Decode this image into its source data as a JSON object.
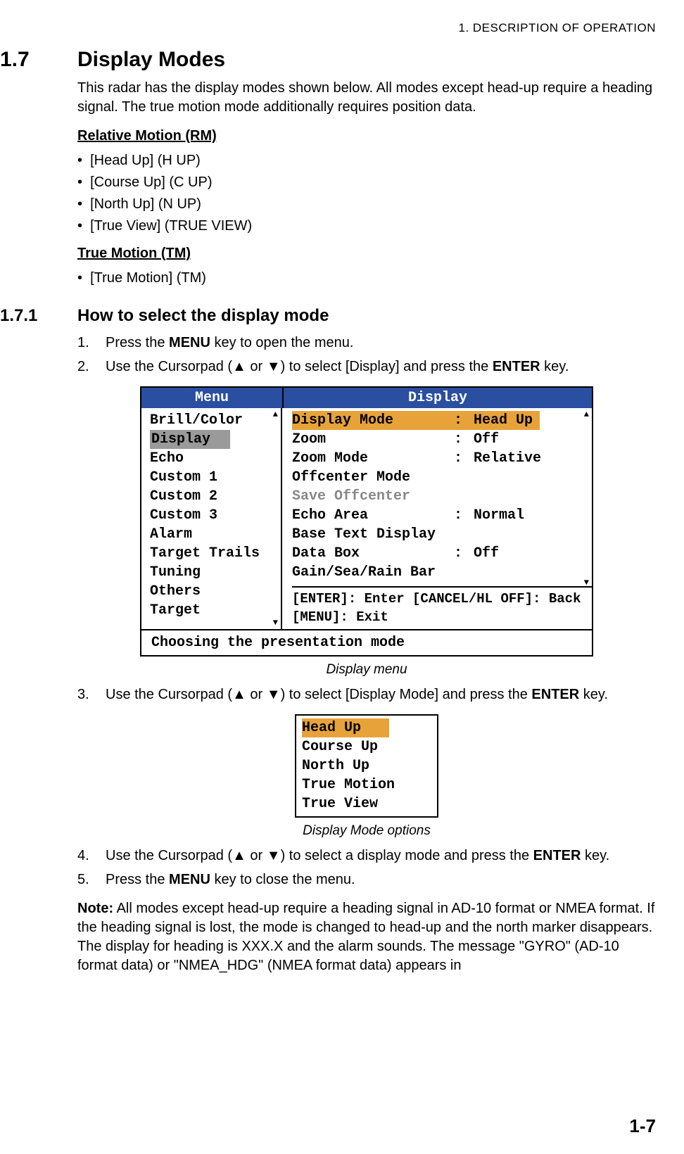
{
  "header": "1.  DESCRIPTION OF OPERATION",
  "section": {
    "num": "1.7",
    "title": "Display Modes"
  },
  "intro": "This radar has the display modes shown below. All modes except head-up require a heading signal. The true motion mode additionally requires position data.",
  "rm": {
    "heading": "Relative Motion (RM)",
    "items": [
      "[Head Up] (H UP)",
      "[Course Up] (C UP)",
      "[North Up] (N UP)",
      "[True View] (TRUE VIEW)"
    ]
  },
  "tm": {
    "heading": "True Motion (TM)",
    "items": [
      "[True Motion] (TM)"
    ]
  },
  "subsection": {
    "num": "1.7.1",
    "title": "How to select the display mode"
  },
  "steps": {
    "s1a": "Press the ",
    "s1b": "MENU",
    "s1c": " key to open the menu.",
    "s2a": "Use the Cursorpad (",
    "s2b": " or ",
    "s2c": ") to select [Display] and press the ",
    "s2d": "ENTER",
    "s2e": " key.",
    "s3a": "Use the Cursorpad (",
    "s3b": " or ",
    "s3c": ") to select [Display Mode] and press the ",
    "s3d": "ENTER",
    "s3e": " key.",
    "s4a": "Use the Cursorpad (",
    "s4b": " or ",
    "s4c": ") to select a display mode and press the ",
    "s4d": "ENTER",
    "s4e": " key.",
    "s5a": "Press the ",
    "s5b": "MENU",
    "s5c": " key to close the menu."
  },
  "arrows": {
    "up": "▲",
    "down": "▼"
  },
  "menu": {
    "head_left": "Menu",
    "head_right": "Display",
    "left_items": [
      "Brill/Color",
      "Display",
      "Echo",
      "Custom 1",
      "Custom 2",
      "Custom 3",
      "Alarm",
      "Target Trails",
      "Tuning",
      "Others",
      "Target"
    ],
    "left_selected_index": 1,
    "right_items": [
      {
        "label": "Display Mode",
        "value": "Head Up",
        "highlight": true
      },
      {
        "label": "Zoom",
        "value": "Off"
      },
      {
        "label": "Zoom Mode",
        "value": "Relative"
      },
      {
        "label": "Offcenter Mode",
        "value": ""
      },
      {
        "label": "Save Offcenter",
        "value": "",
        "grey": true
      },
      {
        "label": "Echo Area",
        "value": "Normal"
      },
      {
        "label": "Base Text Display",
        "value": ""
      },
      {
        "label": "Data Box",
        "value": "Off"
      },
      {
        "label": "Gain/Sea/Rain Bar",
        "value": ""
      }
    ],
    "hints1": "[ENTER]: Enter [CANCEL/HL OFF]: Back",
    "hints2": "[MENU]: Exit",
    "footer": "Choosing the presentation mode"
  },
  "caption1": "Display menu",
  "options": {
    "items": [
      "Head Up",
      "Course Up",
      "North Up",
      "True Motion",
      "True View"
    ],
    "selected_index": 0
  },
  "caption2": "Display Mode options",
  "note_label": "Note:",
  "note_text": " All modes except head-up require a heading signal in AD-10 format or NMEA format. If the heading signal is lost, the mode is changed to head-up and the north marker disappears. The display for heading is XXX.X and the alarm sounds. The message \"GYRO\" (AD-10 format data) or \"NMEA_HDG\" (NMEA format data) appears in",
  "page_num": "1-7"
}
